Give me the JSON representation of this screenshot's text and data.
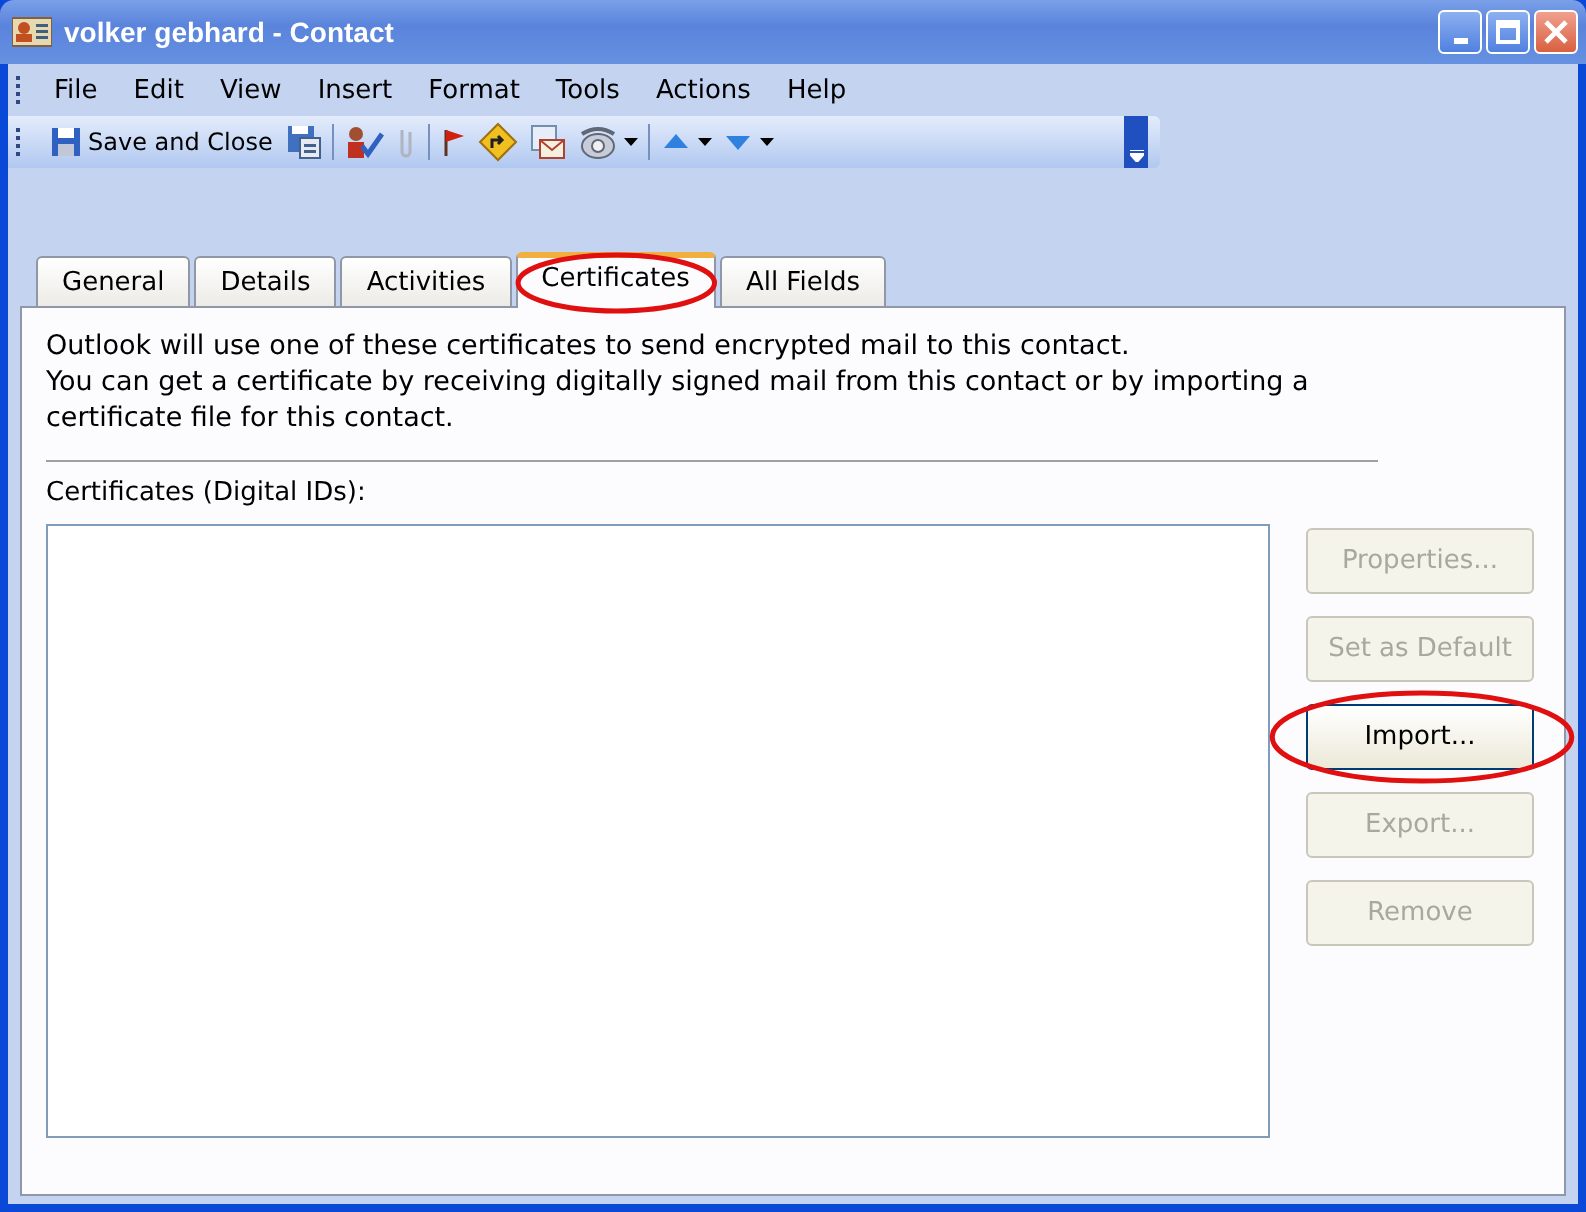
{
  "window": {
    "title": "volker gebhard - Contact"
  },
  "menu": [
    "File",
    "Edit",
    "View",
    "Insert",
    "Format",
    "Tools",
    "Actions",
    "Help"
  ],
  "toolbar": {
    "save_label": "Save and Close"
  },
  "tabs": [
    {
      "label": "General",
      "selected": false,
      "highlighted": false
    },
    {
      "label": "Details",
      "selected": false,
      "highlighted": false
    },
    {
      "label": "Activities",
      "selected": false,
      "highlighted": false
    },
    {
      "label": "Certificates",
      "selected": true,
      "highlighted": true
    },
    {
      "label": "All Fields",
      "selected": false,
      "highlighted": false
    }
  ],
  "description": [
    "Outlook will use one of these certificates to send encrypted mail to this contact.",
    "You can get a certificate by receiving digitally signed mail from this contact or by importing a certificate file for this contact."
  ],
  "list_label": "Certificates (Digital IDs):",
  "buttons": [
    {
      "label": "Properties...",
      "disabled": true,
      "highlighted": false
    },
    {
      "label": "Set as Default",
      "disabled": true,
      "highlighted": false
    },
    {
      "label": "Import...",
      "disabled": false,
      "highlighted": true
    },
    {
      "label": "Export...",
      "disabled": true,
      "highlighted": false
    },
    {
      "label": "Remove",
      "disabled": true,
      "highlighted": false
    }
  ]
}
